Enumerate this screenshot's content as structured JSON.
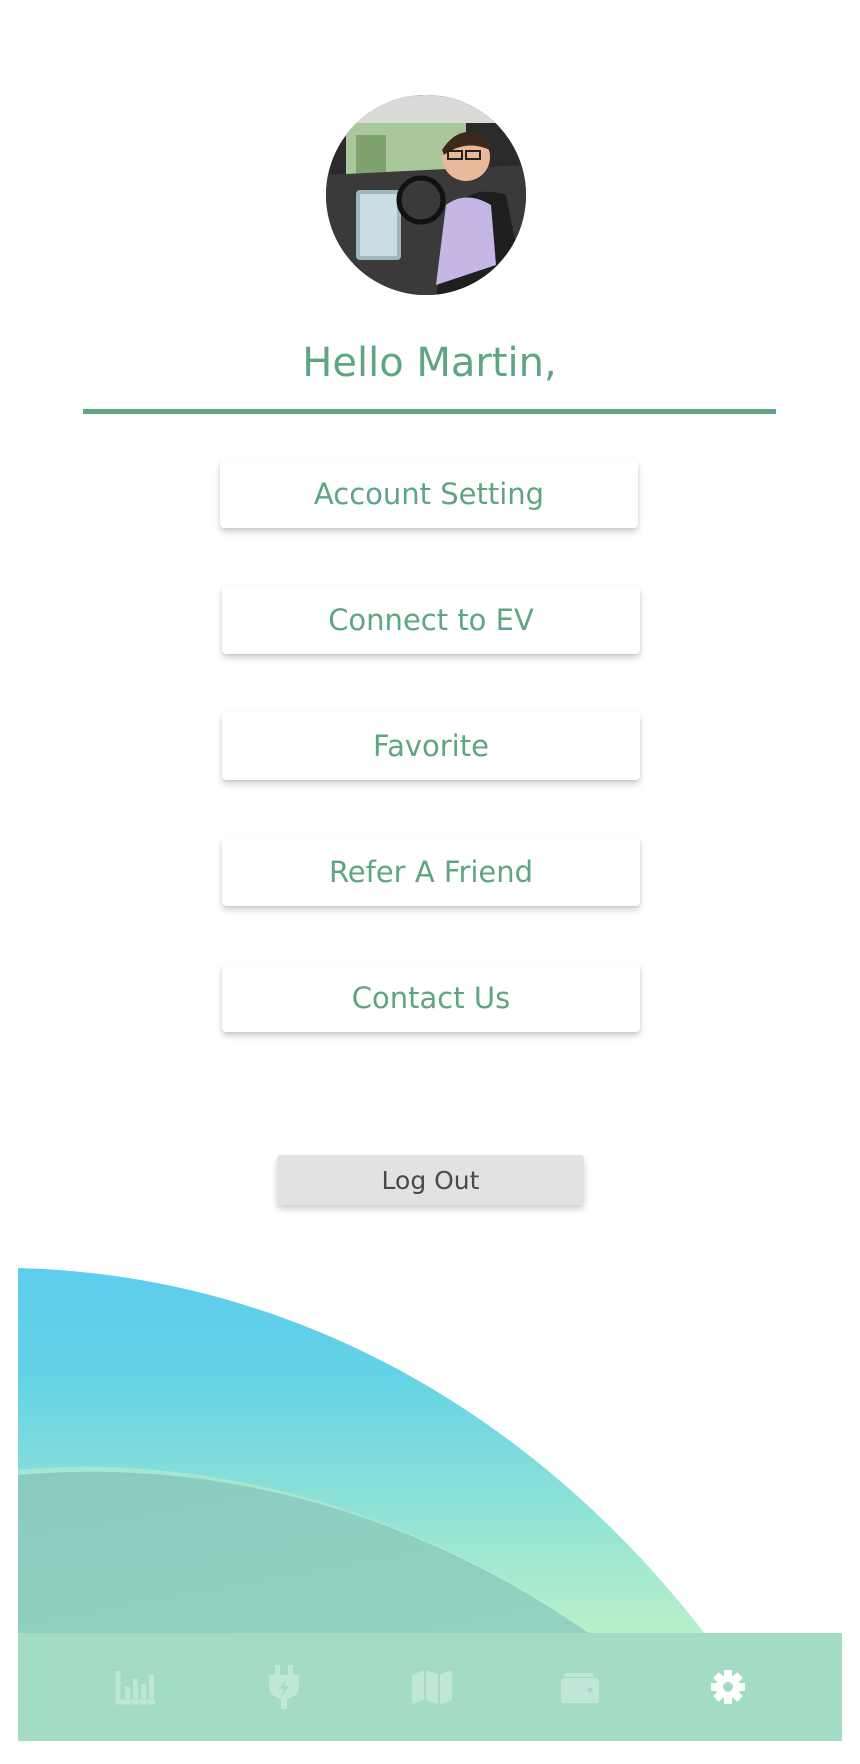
{
  "profile": {
    "greeting": "Hello Martin,"
  },
  "menu": [
    {
      "label": "Account Setting"
    },
    {
      "label": "Connect to EV"
    },
    {
      "label": "Favorite"
    },
    {
      "label": "Refer A Friend"
    },
    {
      "label": "Contact Us"
    }
  ],
  "logout": {
    "label": "Log Out"
  },
  "bottom_nav": {
    "items": [
      {
        "icon": "bar-chart-icon",
        "active": false
      },
      {
        "icon": "ev-plug-icon",
        "active": false
      },
      {
        "icon": "map-icon",
        "active": false
      },
      {
        "icon": "wallet-icon",
        "active": false
      },
      {
        "icon": "gear-icon",
        "active": true
      }
    ]
  },
  "colors": {
    "accent": "#5fa584",
    "nav_background": "#a3dbc4",
    "nav_icon_inactive": "#bfe6d6",
    "nav_icon_active": "#ffffff",
    "wave_blue": "#5ecdee",
    "wave_mint": "#b6efcc"
  }
}
